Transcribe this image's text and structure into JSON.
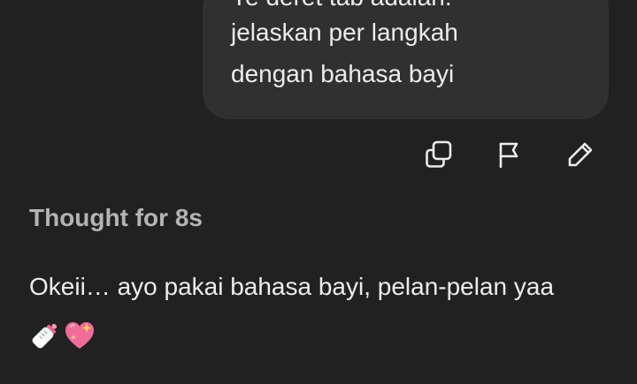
{
  "user_message": {
    "lines": [
      "Ye deret tab adalah:",
      "jelaskan per langkah",
      "dengan bahasa bayi"
    ]
  },
  "actions": {
    "copy_icon": "copy-icon",
    "flag_icon": "flag-icon",
    "edit_icon": "pencil-icon"
  },
  "assistant": {
    "thought_label": "Thought for 8s",
    "reply_text": "Okeii… ayo pakai bahasa bayi, pelan-pelan yaa",
    "emojis": [
      "baby-bottle-icon",
      "sparkling-heart-icon"
    ]
  },
  "colors": {
    "background": "#212121",
    "bubble": "#303030",
    "text": "#ececec",
    "muted": "#b4b4b4"
  }
}
